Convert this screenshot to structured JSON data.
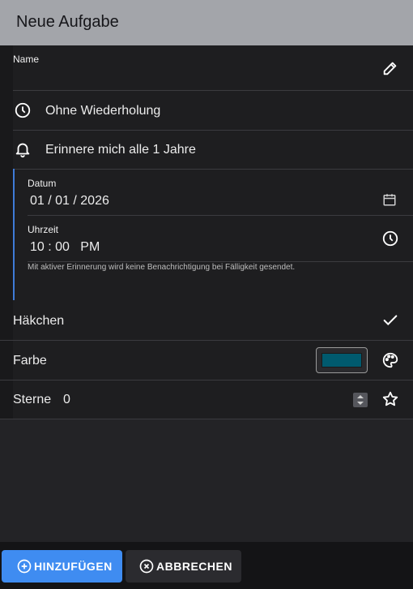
{
  "header": {
    "title": "Neue Aufgabe"
  },
  "name_field": {
    "label": "Name",
    "value": ""
  },
  "repeat": {
    "label": "Ohne Wiederholung"
  },
  "reminder": {
    "label": "Erinnere mich alle 1 Jahre"
  },
  "date_field": {
    "label": "Datum",
    "value": "01 / 01 / 2026"
  },
  "time_field": {
    "label": "Uhrzeit",
    "value": "10 : 00   PM"
  },
  "hint": "Mit aktiver Erinnerung wird keine Benachrichtigung bei Fälligkeit gesendet.",
  "checkmark_row": {
    "label": "Häkchen"
  },
  "color_row": {
    "label": "Farbe",
    "value": "#005a6e"
  },
  "stars_row": {
    "label": "Sterne",
    "value": "0"
  },
  "footer": {
    "add_label": "HINZUFÜGEN",
    "cancel_label": "ABBRECHEN"
  },
  "colors": {
    "accent": "#3f8cf1",
    "header_bg": "#a3a5aa",
    "selected_color": "#005a6e"
  },
  "icons": [
    "edit-icon",
    "clock-icon",
    "bell-icon",
    "calendar-icon",
    "check-icon",
    "palette-icon",
    "star-icon",
    "add-circle-icon",
    "cancel-circle-icon"
  ]
}
